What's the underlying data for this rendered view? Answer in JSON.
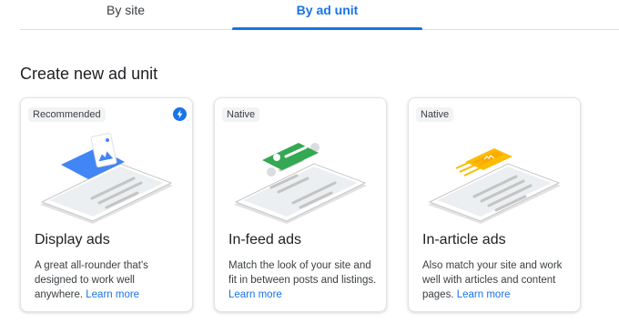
{
  "tabs": [
    {
      "label": "By site",
      "active": false
    },
    {
      "label": "By ad unit",
      "active": true
    }
  ],
  "section_title": "Create new ad unit",
  "cards": [
    {
      "chip": "Recommended",
      "has_bolt_icon": true,
      "illustration_icon": "display-ad-phone-icon",
      "accent_color": "#4285f4",
      "title": "Display ads",
      "description": "A great all-rounder that's designed to work well anywhere.",
      "link": "Learn more"
    },
    {
      "chip": "Native",
      "has_bolt_icon": false,
      "illustration_icon": "in-feed-ad-phone-icon",
      "accent_color": "#34a853",
      "title": "In-feed ads",
      "description": "Match the look of your site and fit in between posts and listings.",
      "link": "Learn more"
    },
    {
      "chip": "Native",
      "has_bolt_icon": false,
      "illustration_icon": "in-article-ad-phone-icon",
      "accent_color": "#fbbc04",
      "title": "In-article ads",
      "description": "Also match your site and work well with articles and content pages.",
      "link": "Learn more"
    }
  ],
  "colors": {
    "primary": "#1a73e8",
    "text": "#202124",
    "secondary_text": "#3c4043"
  }
}
